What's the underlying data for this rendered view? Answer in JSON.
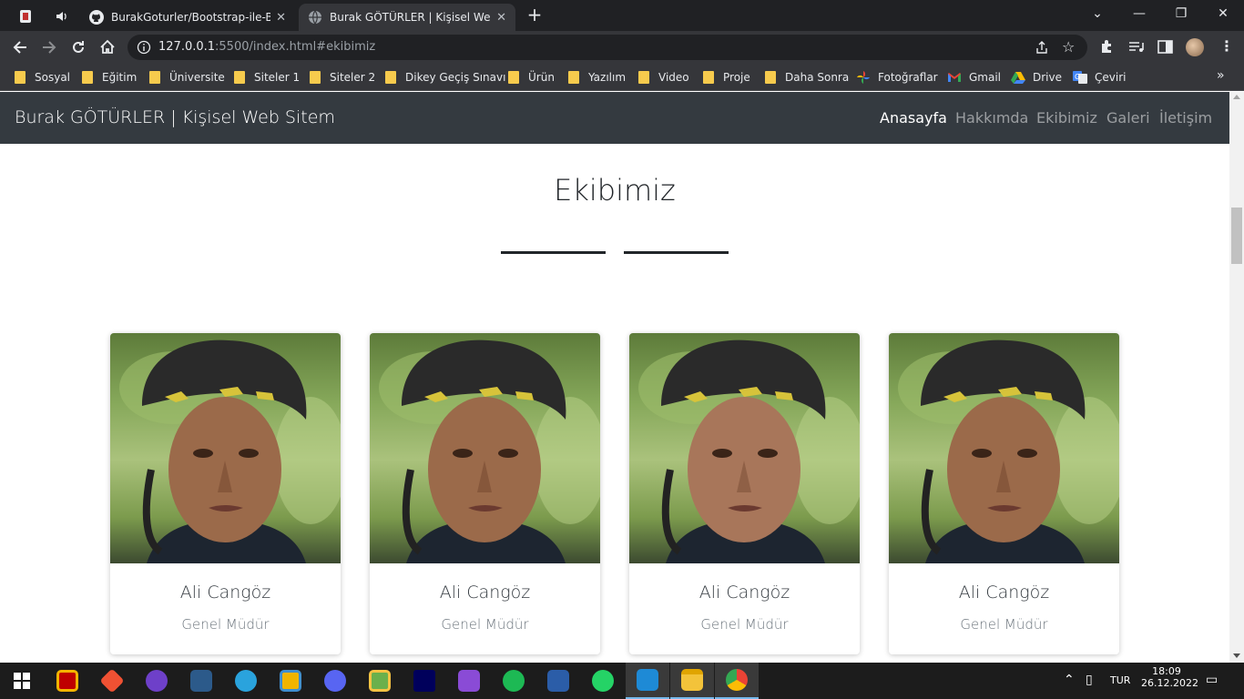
{
  "browser": {
    "tabs": [
      {
        "title": "BurakGoturler/Bootstrap-ile-Basit",
        "active": false
      },
      {
        "title": "Burak GÖTÜRLER | Kişisel Web Sit",
        "active": true
      }
    ],
    "new_tab_label": "+",
    "url_host": "127.0.0.1",
    "url_rest": ":5500/index.html#ekibimiz",
    "window_controls": {
      "minimize": "—",
      "restore": "❐",
      "close": "✕",
      "tab_search": "⌄"
    }
  },
  "bookmarks": [
    {
      "label": "Sosyal",
      "icon": "folder-icon"
    },
    {
      "label": "Eğitim",
      "icon": "folder-icon"
    },
    {
      "label": "Üniversite",
      "icon": "folder-icon"
    },
    {
      "label": "Siteler 1",
      "icon": "folder-icon"
    },
    {
      "label": "Siteler 2",
      "icon": "folder-icon"
    },
    {
      "label": "Dikey Geçiş Sınavı",
      "icon": "folder-icon"
    },
    {
      "label": "Ürün",
      "icon": "folder-icon"
    },
    {
      "label": "Yazılım",
      "icon": "folder-icon"
    },
    {
      "label": "Video",
      "icon": "folder-icon"
    },
    {
      "label": "Proje",
      "icon": "folder-icon"
    },
    {
      "label": "Daha Sonra",
      "icon": "folder-icon"
    },
    {
      "label": "Fotoğraflar",
      "icon": "google-photos-icon"
    },
    {
      "label": "Gmail",
      "icon": "gmail-icon"
    },
    {
      "label": "Drive",
      "icon": "google-drive-icon"
    },
    {
      "label": "Çeviri",
      "icon": "google-translate-icon"
    }
  ],
  "site": {
    "brand": "Burak GÖTÜRLER | Kişisel Web Sitem",
    "nav": [
      {
        "label": "Anasayfa",
        "active": true
      },
      {
        "label": "Hakkımda",
        "active": false
      },
      {
        "label": "Ekibimiz",
        "active": false
      },
      {
        "label": "Galeri",
        "active": false
      },
      {
        "label": "İletişim",
        "active": false
      }
    ],
    "section_title": "Ekibimiz",
    "team": [
      {
        "name": "Ali Cangöz",
        "role": "Genel Müdür"
      },
      {
        "name": "Ali Cangöz",
        "role": "Genel Müdür"
      },
      {
        "name": "Ali Cangöz",
        "role": "Genel Müdür"
      },
      {
        "name": "Ali Cangöz",
        "role": "Genel Müdür"
      }
    ]
  },
  "taskbar": {
    "apps": [
      "start-icon",
      "filezilla-icon",
      "git-icon",
      "github-desktop-icon",
      "mysql-workbench-icon",
      "telegram-icon",
      "box-icon",
      "discord-icon",
      "sourcetree-icon",
      "animate-icon",
      "visual-studio-icon",
      "spotify-icon",
      "virtualbox-icon",
      "whatsapp-icon",
      "vscode-icon",
      "file-explorer-icon",
      "chrome-icon"
    ],
    "language": "TUR",
    "time": "18:09",
    "date": "26.12.2022"
  },
  "colors": {
    "navbar": "#343a40",
    "chrome_dark": "#202124",
    "chrome_toolbar": "#35363a"
  }
}
